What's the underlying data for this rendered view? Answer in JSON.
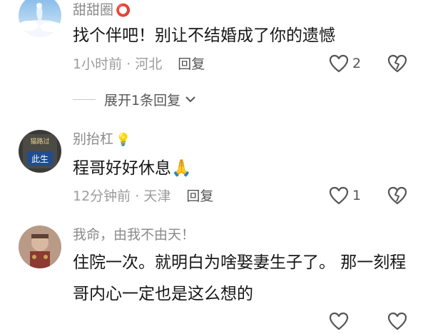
{
  "comments": [
    {
      "username": "甜甜圈",
      "username_suffix": "⭕",
      "text": "找个伴吧！别让不结婚成了你的遗憾",
      "time": "1小时前",
      "location": "河北",
      "reply_label": "回复",
      "like_count": "2",
      "expand_label": "展开1条回复"
    },
    {
      "username": "别抬杠",
      "username_suffix": "💡",
      "text": "程哥好好休息",
      "text_emoji": "🙏",
      "time": "12分钟前",
      "location": "天津",
      "reply_label": "回复",
      "like_count": "1",
      "avatar_badge_top": "猫路过",
      "avatar_badge_bottom": "此生"
    },
    {
      "username": "我命，由我不由天！",
      "text": "住院一次。就明白为啥娶妻生子了。 那一刻程哥内心一定也是这么想的"
    }
  ],
  "colors": {
    "username": "#8a8a8a",
    "text": "#161616",
    "meta": "#9b9b9b",
    "icon": "#555555"
  },
  "icons": {
    "like": "heart-outline-icon",
    "dislike": "broken-heart-icon",
    "expand": "chevron-down-icon"
  }
}
